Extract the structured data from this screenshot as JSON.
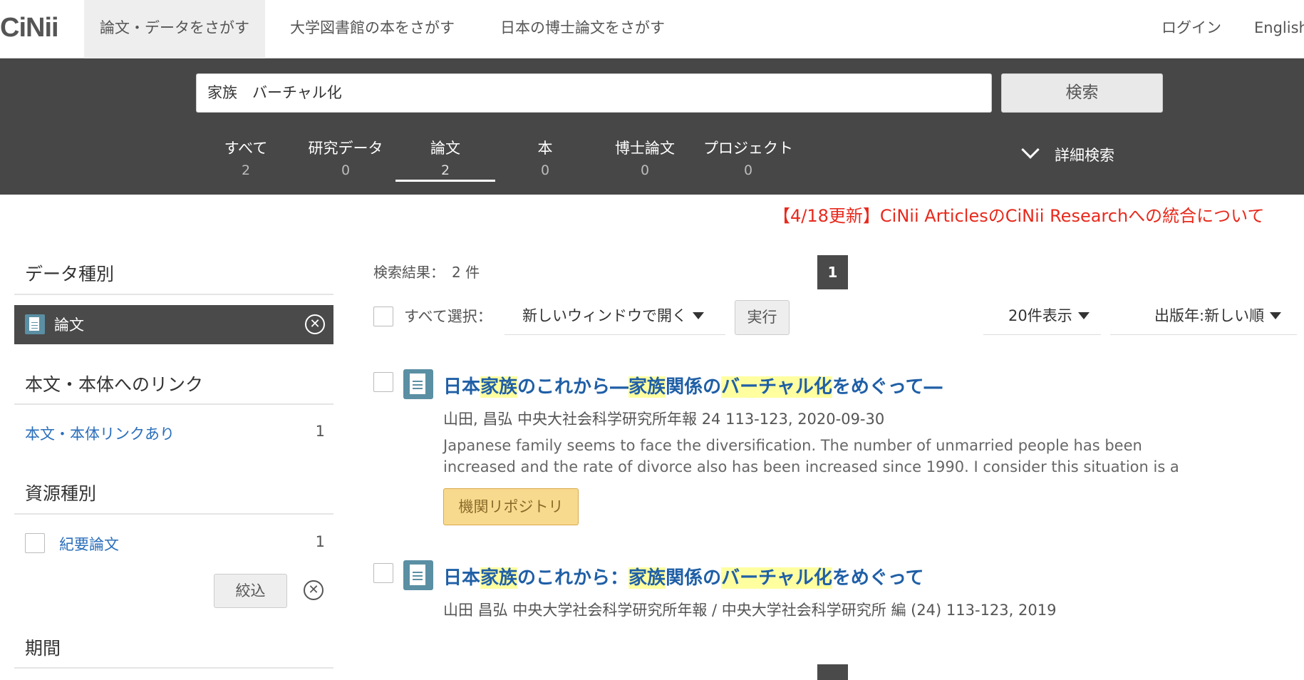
{
  "header": {
    "logo": "CiNii",
    "tabs": [
      {
        "label": "論文・データをさがす"
      },
      {
        "label": "大学図書館の本をさがす"
      },
      {
        "label": "日本の博士論文をさがす"
      }
    ],
    "login": "ログイン",
    "language": "English"
  },
  "search": {
    "query": "家族　バーチャル化",
    "button": "検索",
    "advanced": "詳細検索",
    "categories": [
      {
        "label": "すべて",
        "count": "2"
      },
      {
        "label": "研究データ",
        "count": "0"
      },
      {
        "label": "論文",
        "count": "2"
      },
      {
        "label": "本",
        "count": "0"
      },
      {
        "label": "博士論文",
        "count": "0"
      },
      {
        "label": "プロジェクト",
        "count": "0"
      }
    ],
    "active_category": "論文"
  },
  "notice": "【4/18更新】CiNii ArticlesのCiNii Researchへの統合について",
  "sidebar": {
    "data_type": {
      "title": "データ種別",
      "selected": "論文"
    },
    "fulltext": {
      "title": "本文・本体へのリンク",
      "link": "本文・本体リンクあり",
      "count": "1"
    },
    "resource": {
      "title": "資源種別",
      "option": "紀要論文",
      "count": "1",
      "filter_button": "絞込"
    },
    "period": {
      "title": "期間"
    }
  },
  "results": {
    "count_label": "検索結果：　2 件",
    "page": "1",
    "select_all": "すべて選択：",
    "open_window": "新しいウィンドウで開く",
    "execute": "実行",
    "per_page": "20件表示",
    "sort": "出版年:新しい順",
    "items": [
      {
        "title_parts": [
          "日本",
          "家族",
          "のこれから―",
          "家族",
          "関係の",
          "バーチャル化",
          "をめぐって―"
        ],
        "meta": "山田, 昌弘 中央大社会科学研究所年報 24 113-123, 2020-09-30",
        "abstract": "Japanese family seems to face the diversification. The number of unmarried people has been increased and the rate of divorce also has been increased since 1990. I consider this situation is a …",
        "badge": "機関リポジトリ"
      },
      {
        "title_parts": [
          "日本",
          "家族",
          "のこれから：",
          "家族",
          "関係の",
          "バーチャル化",
          "をめぐって"
        ],
        "meta": "山田 昌弘 中央大学社会科学研究所年報 / 中央大学社会科学研究所 編 (24) 113-123, 2019"
      }
    ]
  },
  "colors": {
    "header_band": "#474747",
    "link_blue": "#1f5fa6",
    "highlight": "#ffffa0",
    "notice_red": "#e8291c",
    "badge_bg": "#f8da8e",
    "doc_icon": "#5b8fa3"
  }
}
